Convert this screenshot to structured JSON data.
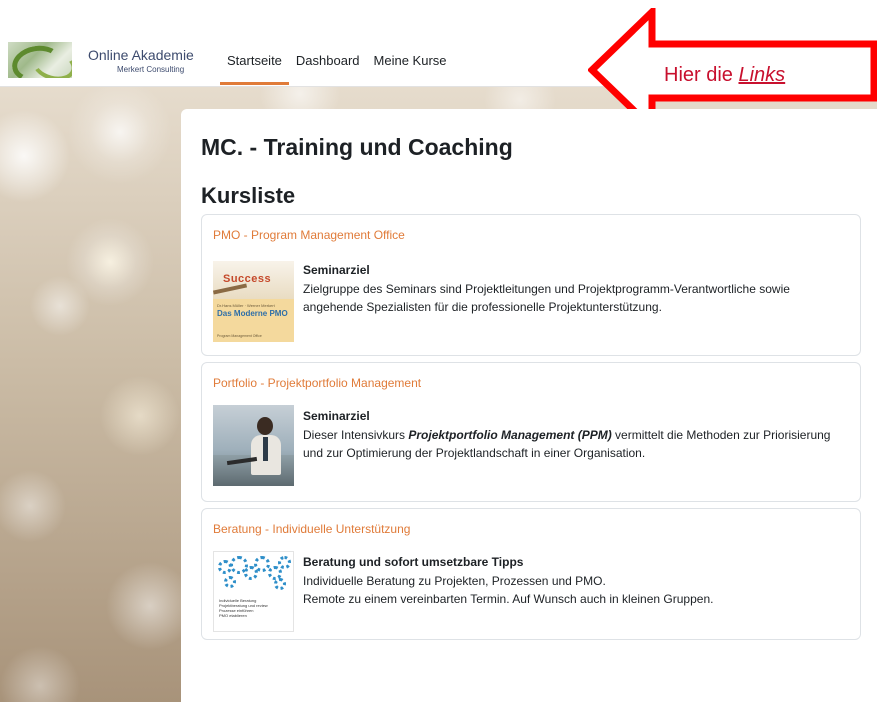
{
  "header": {
    "brand_title": "Online Akademie",
    "brand_subtitle": "Merkert Consulting",
    "nav": [
      {
        "label": "Startseite",
        "active": true
      },
      {
        "label": "Dashboard",
        "active": false
      },
      {
        "label": "Meine Kurse",
        "active": false
      }
    ]
  },
  "callout": {
    "text": "Hier die",
    "link_word": "Links",
    "color": "#c8102e"
  },
  "main": {
    "page_title": "MC. - Training und Coaching",
    "section_title": "Kursliste",
    "courses": [
      {
        "link": "PMO - Program Management Office",
        "heading": "Seminarziel",
        "text": "Zielgruppe des Seminars sind Projektleitungen und Projektprogramm-Verantwortliche sowie angehende Spezialisten für die professionelle Projektunterstützung.",
        "thumb_word": "Success",
        "thumb_small": "Dr.Hans Müller · Werner Merkert",
        "thumb_title": "Das Moderne PMO",
        "thumb_sub": "Program Management Office"
      },
      {
        "link": "Portfolio - Projektportfolio Management",
        "heading": "Seminarziel",
        "text_before": "Dieser Intensivkurs ",
        "text_emph": "Projektportfolio Management (PPM)",
        "text_after": " vermittelt die Methoden zur Priorisierung und zur Optimierung der Projektlandschaft in einer Organisation."
      },
      {
        "link": "Beratung - Individuelle Unterstützung",
        "heading": "Beratung und sofort umsetzbare Tipps",
        "line1": "Individuelle Beratung zu Projekten, Prozessen und PMO.",
        "line2": "Remote zu einem vereinbarten Termin. Auf Wunsch auch in kleinen Gruppen.",
        "thumb_label": "Individuelle Beratung",
        "thumb_items": [
          "Projektberatung und review",
          "Prozesse einführen",
          "PMO etablieren"
        ]
      }
    ]
  },
  "colors": {
    "accent": "#e07b39",
    "brand_text": "#3d4b6e"
  }
}
